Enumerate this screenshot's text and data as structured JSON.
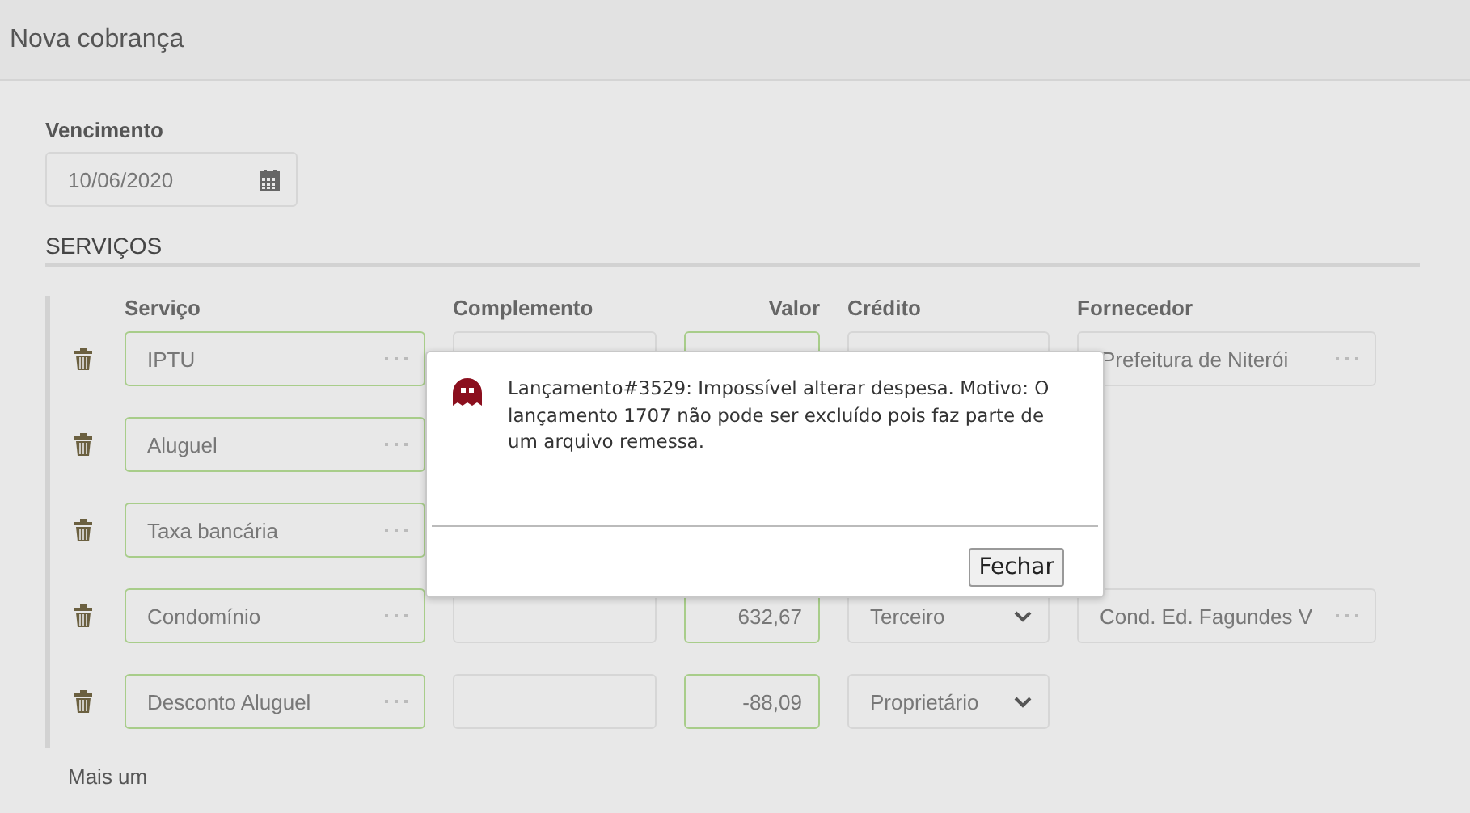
{
  "header": {
    "title": "Nova cobrança"
  },
  "vencimento": {
    "label": "Vencimento",
    "value": "10/06/2020"
  },
  "section": {
    "title": "SERVIÇOS"
  },
  "columns": [
    "Serviço",
    "Complemento",
    "Valor",
    "Crédito",
    "Fornecedor"
  ],
  "rows": [
    {
      "servico": "IPTU",
      "fornecedor": "Prefeitura de Niterói"
    },
    {
      "servico": "Aluguel"
    },
    {
      "servico": "Taxa bancária"
    },
    {
      "servico": "Condomínio",
      "valor": "632,67",
      "credito": "Terceiro",
      "fornecedor": "Cond. Ed. Fagundes V"
    },
    {
      "servico": "Desconto Aluguel",
      "valor": "-88,09",
      "credito": "Proprietário"
    }
  ],
  "add_link": "Mais um",
  "dialog": {
    "message": "Lançamento#3529: Impossível alterar despesa. Motivo: O lançamento 1707 não pode ser excluído pois faz parte de um arquivo remessa.",
    "button": "Fechar"
  }
}
